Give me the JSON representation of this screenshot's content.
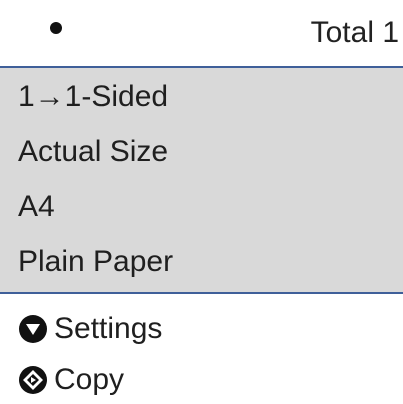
{
  "header": {
    "bullet": "●",
    "total_label": "Total 1"
  },
  "settings": {
    "sides": "1→1-Sided",
    "size": "Actual Size",
    "paper_size": "A4",
    "paper_type": "Plain Paper"
  },
  "footer": {
    "settings_label": "Settings",
    "settings_icon": "down-triangle-icon",
    "copy_label": "Copy",
    "copy_icon": "start-diamond-icon"
  },
  "colors": {
    "panel_background": "#d9d9d9",
    "divider": "#3f5f99",
    "text": "#1f1f1f"
  }
}
